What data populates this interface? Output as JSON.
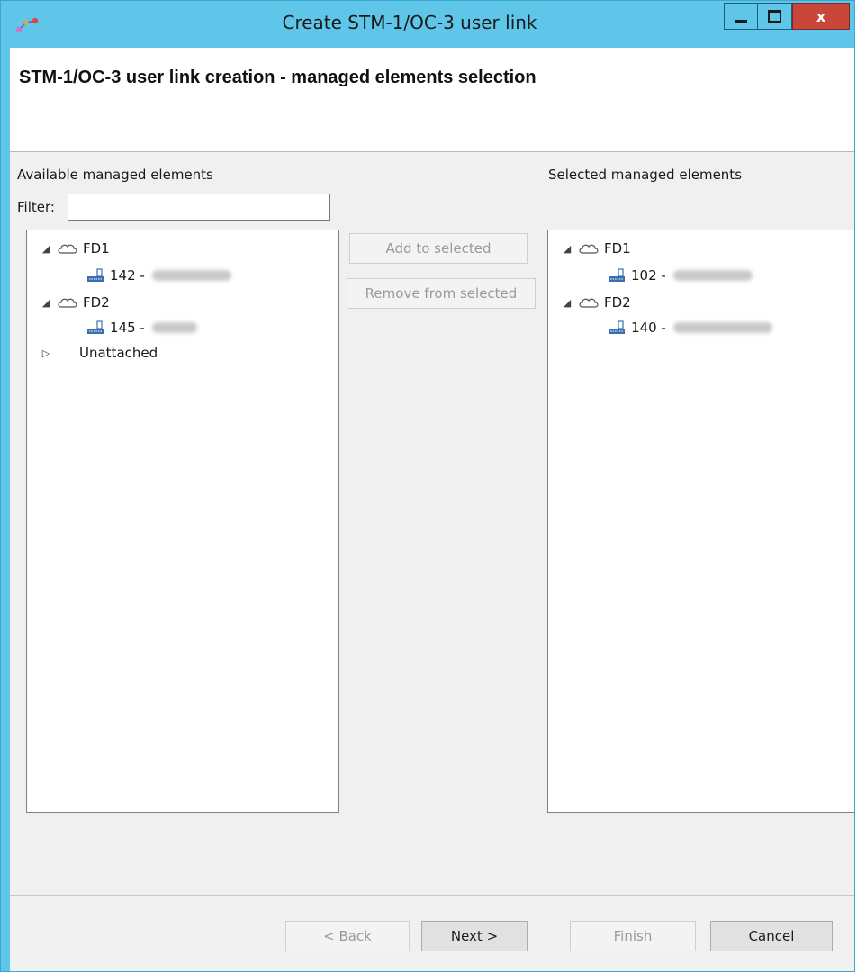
{
  "window": {
    "title": "Create STM-1/OC-3 user link",
    "controls": {
      "minimize": "—",
      "maximize": "□",
      "close": "x"
    }
  },
  "header": {
    "title": "STM-1/OC-3 user link creation - managed elements selection"
  },
  "available": {
    "label": "Available managed elements",
    "filter_label": "Filter:",
    "filter_value": "",
    "tree": [
      {
        "group": "FD1",
        "expander": "◢",
        "children": [
          {
            "label": "142 -"
          }
        ]
      },
      {
        "group": "FD2",
        "expander": "◢",
        "children": [
          {
            "label": "145 -"
          }
        ]
      },
      {
        "group": "Unattached",
        "expander": "▷"
      }
    ]
  },
  "selected": {
    "label": "Selected managed elements",
    "tree": [
      {
        "group": "FD1",
        "expander": "◢",
        "children": [
          {
            "label": "102 -"
          }
        ]
      },
      {
        "group": "FD2",
        "expander": "◢",
        "children": [
          {
            "label": "140 -"
          }
        ]
      }
    ]
  },
  "actions": {
    "add": "Add to selected",
    "remove": "Remove from selected"
  },
  "footer": {
    "back": "< Back",
    "next": "Next >",
    "finish": "Finish",
    "cancel": "Cancel"
  },
  "colors": {
    "titlebar": "#5fc6e9",
    "close": "#c9463a",
    "panel": "#f0f0f0"
  }
}
